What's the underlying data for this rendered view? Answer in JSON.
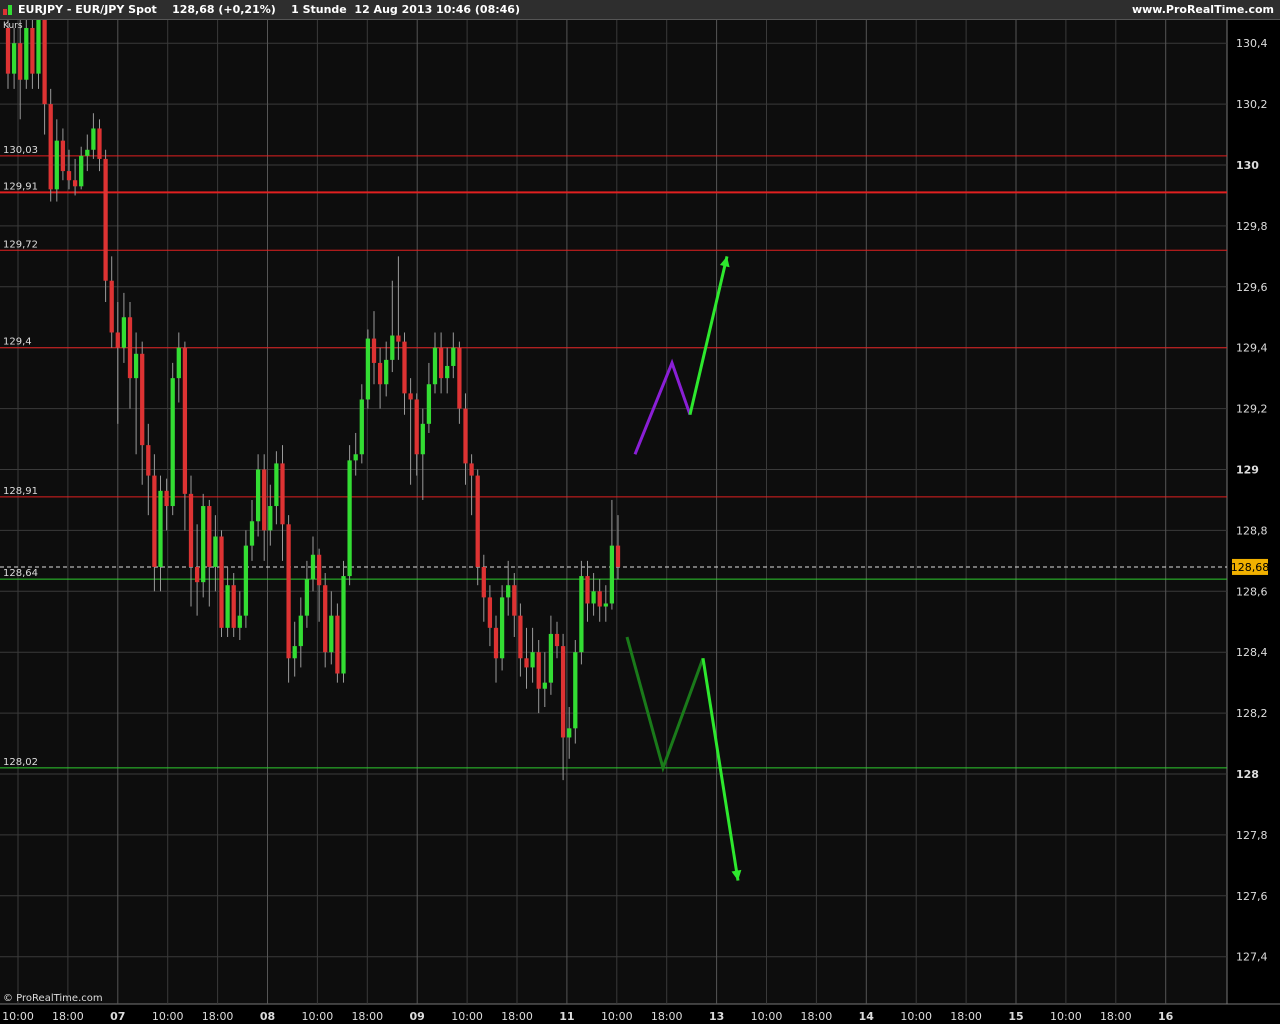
{
  "header": {
    "title": "EURJPY - EUR/JPY Spot    128,68 (+0,21%)    1 Stunde  12 Aug 2013 10:46 (08:46)",
    "site": "www.ProRealTime.com",
    "kurs_label": "Kurs",
    "copyright": "© ProRealTime.com"
  },
  "colors": {
    "background": "#0d0d0d",
    "grid": "#3a3a3a",
    "up_candle": "#33dd33",
    "down_candle": "#dd3333",
    "resistance_line": "#e02020",
    "support_line": "#2ecc2e",
    "current_price_box": "#f0b000",
    "projection_purple": "#8a1fd6",
    "projection_dark_green": "#1a7a1a",
    "projection_light_green": "#2ee82e"
  },
  "chart_data": {
    "type": "candlestick",
    "instrument": "EURJPY - EUR/JPY Spot",
    "timeframe": "1 Stunde",
    "last_price": 128.68,
    "change": "+0,21%",
    "ylim": [
      127.25,
      130.5
    ],
    "y_ticks": [
      "130,4",
      "130,2",
      "130",
      "129,8",
      "129,6",
      "129,4",
      "129,2",
      "129",
      "128,8",
      "128,6",
      "128,4",
      "128,2",
      "128",
      "127,8",
      "127,6",
      "127,4"
    ],
    "x_ticks": [
      "10:00",
      "18:00",
      "07",
      "10:00",
      "18:00",
      "08",
      "10:00",
      "18:00",
      "09",
      "10:00",
      "18:00",
      "11",
      "10:00",
      "18:00",
      "13",
      "10:00",
      "18:00",
      "14",
      "10:00",
      "18:00",
      "15",
      "10:00",
      "18:00",
      "16"
    ],
    "horizontal_levels": [
      {
        "label": "130,03",
        "value": 130.03,
        "color": "red"
      },
      {
        "label": "129,91",
        "value": 129.91,
        "color": "red"
      },
      {
        "label": "129,72",
        "value": 129.72,
        "color": "red"
      },
      {
        "label": "129,4",
        "value": 129.4,
        "color": "red"
      },
      {
        "label": "128,91",
        "value": 128.91,
        "color": "red"
      },
      {
        "label": "128,64",
        "value": 128.64,
        "color": "green"
      },
      {
        "label": "128,02",
        "value": 128.02,
        "color": "green"
      }
    ],
    "current_price_label": "128,68",
    "candles": [
      [
        130.45,
        130.3,
        130.5,
        130.25
      ],
      [
        130.3,
        130.4,
        130.45,
        130.25
      ],
      [
        130.4,
        130.28,
        130.5,
        130.15
      ],
      [
        130.28,
        130.45,
        130.5,
        130.25
      ],
      [
        130.45,
        130.3,
        130.5,
        130.25
      ],
      [
        130.3,
        130.48,
        130.52,
        130.25
      ],
      [
        130.48,
        130.2,
        130.5,
        130.1
      ],
      [
        130.2,
        129.92,
        130.25,
        129.88
      ],
      [
        129.92,
        130.08,
        130.15,
        129.88
      ],
      [
        130.08,
        129.98,
        130.12,
        129.95
      ],
      [
        129.98,
        129.95,
        130.05,
        129.92
      ],
      [
        129.95,
        129.93,
        130.02,
        129.9
      ],
      [
        129.93,
        130.03,
        130.06,
        129.92
      ],
      [
        130.03,
        130.05,
        130.1,
        129.98
      ],
      [
        130.05,
        130.12,
        130.17,
        130.02
      ],
      [
        130.12,
        130.02,
        130.15,
        129.98
      ],
      [
        130.02,
        129.62,
        130.05,
        129.55
      ],
      [
        129.62,
        129.45,
        129.7,
        129.4
      ],
      [
        129.45,
        129.4,
        129.55,
        129.15
      ],
      [
        129.4,
        129.5,
        129.58,
        129.35
      ],
      [
        129.5,
        129.3,
        129.55,
        129.2
      ],
      [
        129.3,
        129.38,
        129.45,
        129.05
      ],
      [
        129.38,
        129.08,
        129.42,
        128.95
      ],
      [
        129.08,
        128.98,
        129.15,
        128.85
      ],
      [
        128.98,
        128.68,
        129.05,
        128.6
      ],
      [
        128.68,
        128.93,
        128.98,
        128.6
      ],
      [
        128.93,
        128.88,
        128.97,
        128.8
      ],
      [
        128.88,
        129.3,
        129.35,
        128.85
      ],
      [
        129.3,
        129.4,
        129.45,
        129.22
      ],
      [
        129.4,
        128.92,
        129.42,
        128.8
      ],
      [
        128.92,
        128.68,
        128.98,
        128.55
      ],
      [
        128.68,
        128.63,
        128.82,
        128.52
      ],
      [
        128.63,
        128.88,
        128.92,
        128.58
      ],
      [
        128.88,
        128.68,
        128.9,
        128.55
      ],
      [
        128.68,
        128.78,
        128.85,
        128.6
      ],
      [
        128.78,
        128.48,
        128.8,
        128.45
      ],
      [
        128.48,
        128.62,
        128.68,
        128.45
      ],
      [
        128.62,
        128.48,
        128.66,
        128.45
      ],
      [
        128.48,
        128.52,
        128.6,
        128.44
      ],
      [
        128.52,
        128.75,
        128.8,
        128.48
      ],
      [
        128.75,
        128.83,
        128.9,
        128.7
      ],
      [
        128.83,
        129.0,
        129.05,
        128.78
      ],
      [
        129.0,
        128.8,
        129.05,
        128.7
      ],
      [
        128.8,
        128.88,
        128.95,
        128.75
      ],
      [
        128.88,
        129.02,
        129.06,
        128.82
      ],
      [
        129.02,
        128.82,
        129.08,
        128.7
      ],
      [
        128.82,
        128.38,
        128.85,
        128.3
      ],
      [
        128.38,
        128.42,
        128.5,
        128.32
      ],
      [
        128.42,
        128.52,
        128.58,
        128.35
      ],
      [
        128.52,
        128.64,
        128.7,
        128.48
      ],
      [
        128.64,
        128.72,
        128.78,
        128.6
      ],
      [
        128.72,
        128.62,
        128.74,
        128.5
      ],
      [
        128.62,
        128.4,
        128.66,
        128.35
      ],
      [
        128.4,
        128.52,
        128.6,
        128.36
      ],
      [
        128.52,
        128.33,
        128.56,
        128.3
      ],
      [
        128.33,
        128.65,
        128.7,
        128.3
      ],
      [
        128.65,
        129.03,
        129.08,
        128.62
      ],
      [
        129.03,
        129.05,
        129.12,
        128.98
      ],
      [
        129.05,
        129.23,
        129.28,
        129.02
      ],
      [
        129.23,
        129.43,
        129.46,
        129.2
      ],
      [
        129.43,
        129.35,
        129.52,
        129.28
      ],
      [
        129.35,
        129.28,
        129.4,
        129.2
      ],
      [
        129.28,
        129.36,
        129.42,
        129.24
      ],
      [
        129.36,
        129.44,
        129.62,
        129.32
      ],
      [
        129.44,
        129.42,
        129.7,
        129.36
      ],
      [
        129.42,
        129.25,
        129.45,
        129.18
      ],
      [
        129.25,
        129.23,
        129.3,
        128.95
      ],
      [
        129.23,
        129.05,
        129.25,
        128.98
      ],
      [
        129.05,
        129.15,
        129.2,
        128.9
      ],
      [
        129.15,
        129.28,
        129.35,
        129.12
      ],
      [
        129.28,
        129.4,
        129.45,
        129.25
      ],
      [
        129.4,
        129.3,
        129.45,
        129.25
      ],
      [
        129.3,
        129.34,
        129.4,
        129.25
      ],
      [
        129.34,
        129.4,
        129.45,
        129.3
      ],
      [
        129.4,
        129.2,
        129.42,
        129.15
      ],
      [
        129.2,
        129.02,
        129.25,
        128.95
      ],
      [
        129.02,
        128.98,
        129.05,
        128.85
      ],
      [
        128.98,
        128.68,
        129.0,
        128.62
      ],
      [
        128.68,
        128.58,
        128.72,
        128.5
      ],
      [
        128.58,
        128.48,
        128.62,
        128.42
      ],
      [
        128.48,
        128.38,
        128.52,
        128.3
      ],
      [
        128.38,
        128.58,
        128.62,
        128.34
      ],
      [
        128.58,
        128.62,
        128.7,
        128.52
      ],
      [
        128.62,
        128.52,
        128.66,
        128.45
      ],
      [
        128.52,
        128.38,
        128.56,
        128.32
      ],
      [
        128.38,
        128.35,
        128.48,
        128.28
      ],
      [
        128.35,
        128.4,
        128.48,
        128.3
      ],
      [
        128.4,
        128.28,
        128.44,
        128.2
      ],
      [
        128.28,
        128.3,
        128.4,
        128.22
      ],
      [
        128.3,
        128.46,
        128.52,
        128.26
      ],
      [
        128.46,
        128.42,
        128.5,
        128.38
      ],
      [
        128.42,
        128.12,
        128.46,
        127.98
      ],
      [
        128.12,
        128.15,
        128.22,
        128.05
      ],
      [
        128.15,
        128.4,
        128.44,
        128.1
      ],
      [
        128.4,
        128.65,
        128.7,
        128.36
      ],
      [
        128.65,
        128.56,
        128.7,
        128.5
      ],
      [
        128.56,
        128.6,
        128.66,
        128.52
      ],
      [
        128.6,
        128.55,
        128.64,
        128.5
      ],
      [
        128.55,
        128.56,
        128.62,
        128.5
      ],
      [
        128.56,
        128.75,
        128.9,
        128.54
      ],
      [
        128.75,
        128.68,
        128.85,
        128.64
      ]
    ],
    "projections": [
      {
        "color": "purple",
        "points": [
          [
            129.05
          ],
          [
            129.35
          ],
          [
            129.18
          ]
        ]
      },
      {
        "color": "light-green",
        "direction": "up",
        "points": [
          [
            129.18
          ],
          [
            129.7
          ]
        ]
      },
      {
        "color": "dark-green",
        "points": [
          [
            128.45
          ],
          [
            128.02
          ],
          [
            128.38
          ]
        ]
      },
      {
        "color": "light-green",
        "direction": "down",
        "points": [
          [
            128.38
          ],
          [
            127.65
          ]
        ]
      }
    ]
  }
}
